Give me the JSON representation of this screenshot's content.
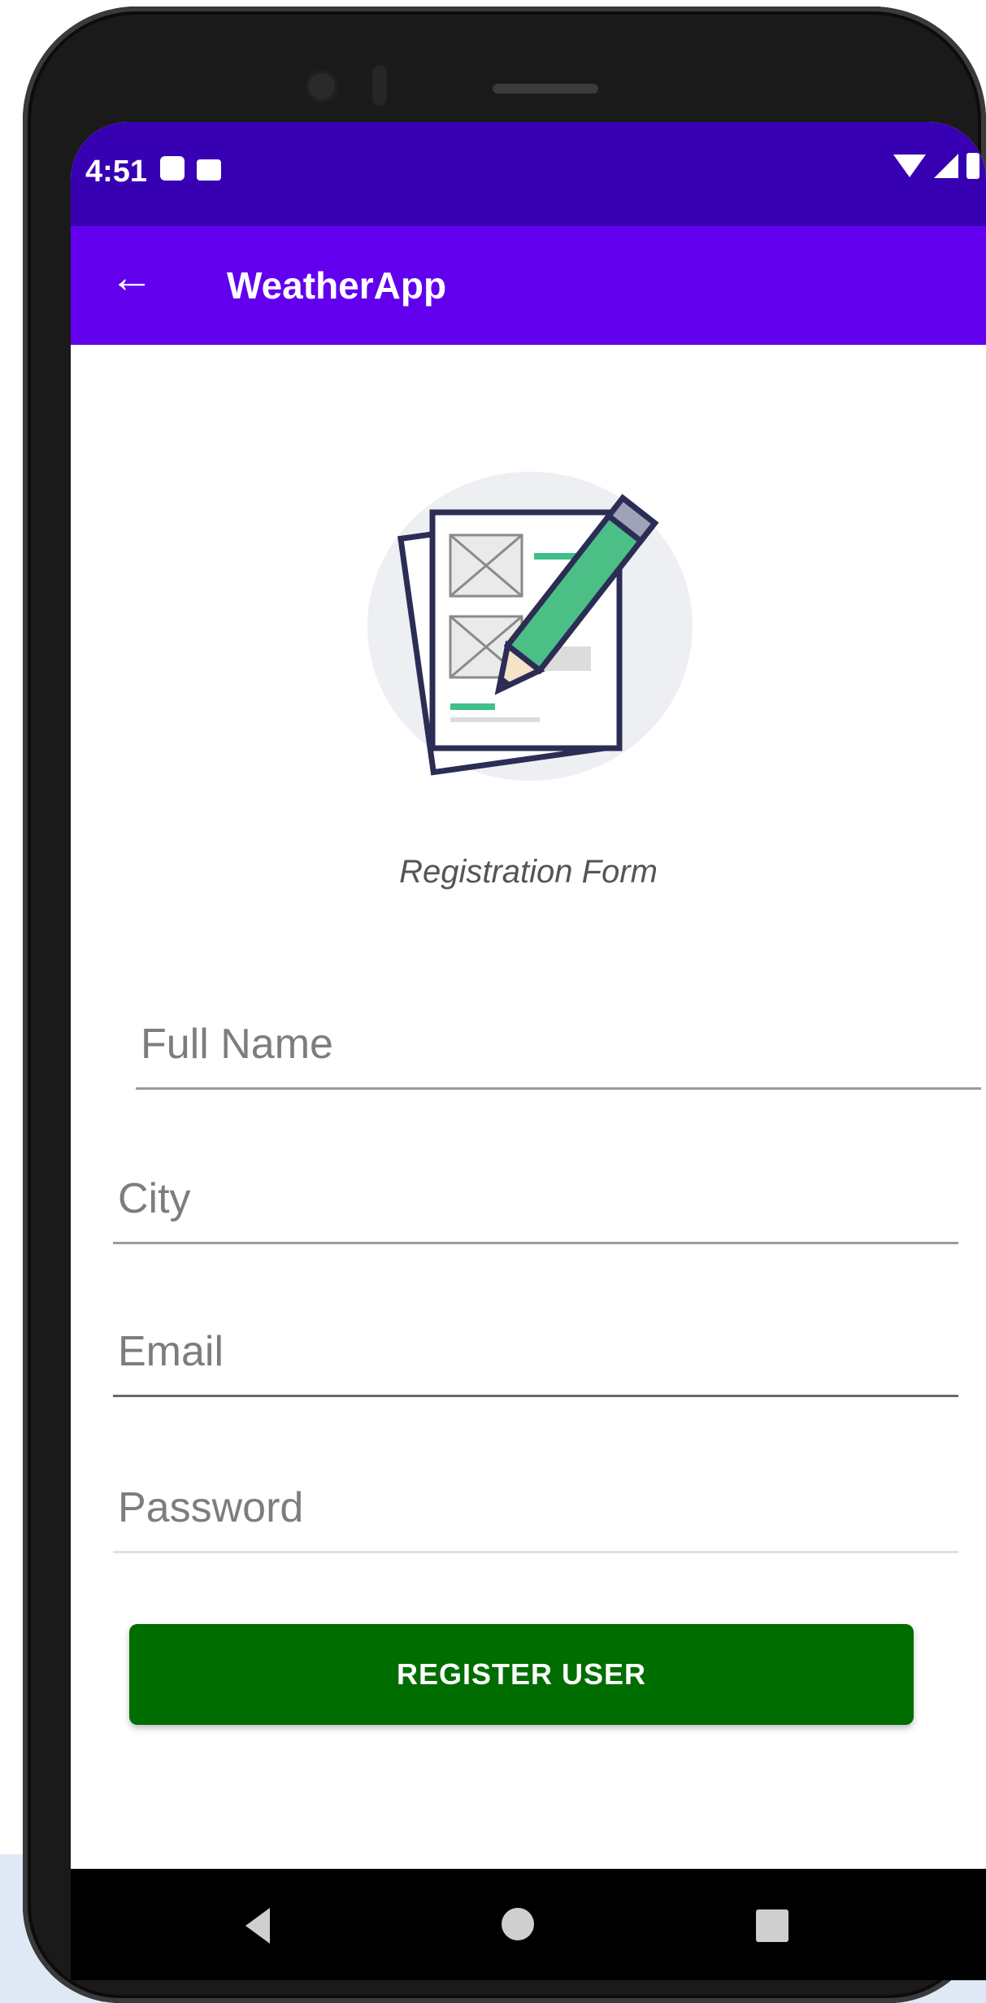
{
  "status_bar": {
    "time": "4:51",
    "icons_left": [
      "notification-icon",
      "sd-card-icon"
    ],
    "icons_right": [
      "wifi-icon",
      "signal-icon",
      "battery-icon"
    ],
    "color": "#3700b3"
  },
  "app_bar": {
    "title": "WeatherApp",
    "back_icon": "←",
    "color": "#6200ee"
  },
  "form": {
    "title": "Registration Form",
    "fields": [
      {
        "placeholder": "Full Name",
        "value": ""
      },
      {
        "placeholder": "City",
        "value": ""
      },
      {
        "placeholder": "Email",
        "value": ""
      },
      {
        "placeholder": "Password",
        "value": ""
      }
    ],
    "submit_label": "REGISTER USER",
    "submit_color": "#006d00"
  },
  "nav_bar": {
    "buttons": [
      "back-icon",
      "home-icon",
      "recents-icon"
    ]
  }
}
